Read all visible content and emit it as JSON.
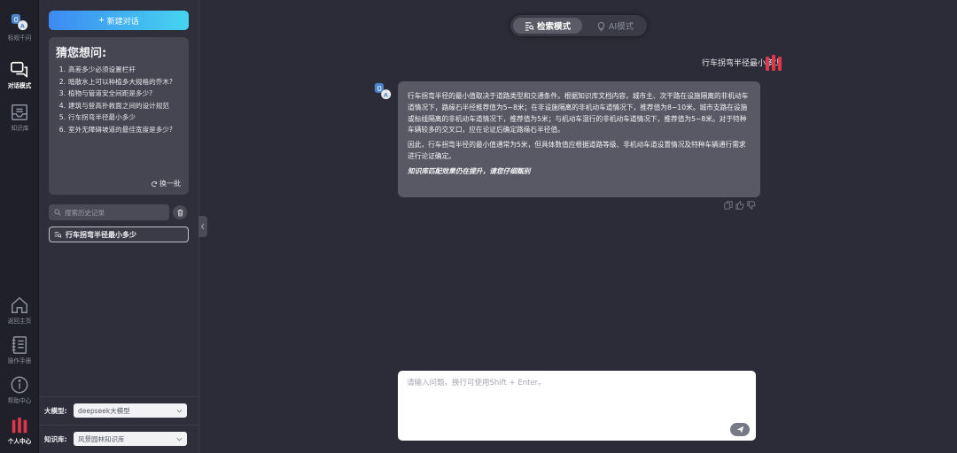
{
  "rail": {
    "items": [
      {
        "label": "标规千问",
        "icon": "app-logo-icon"
      },
      {
        "label": "对话模式",
        "icon": "chat-icon",
        "active": true
      },
      {
        "label": "知识库",
        "icon": "inbox-icon"
      },
      {
        "label": "返回主页",
        "icon": "home-icon"
      },
      {
        "label": "操作手册",
        "icon": "manual-icon"
      },
      {
        "label": "帮助中心",
        "icon": "info-icon"
      },
      {
        "label": "个人中心",
        "icon": "user-icon"
      }
    ]
  },
  "sidebar": {
    "new_chat_label": "新建对话",
    "guess": {
      "title": "猜您想问:",
      "items": [
        {
          "num": "1.",
          "text": "高差多少必须设置栏杆"
        },
        {
          "num": "2.",
          "text": "暗散水上可以种植多大规格的乔木?"
        },
        {
          "num": "3.",
          "text": "植物与管道安全间距是多少?"
        },
        {
          "num": "4.",
          "text": "建筑与登高扑救面之间的设计规范"
        },
        {
          "num": "5.",
          "text": "行车拐弯半径最小多少"
        },
        {
          "num": "6.",
          "text": "室外无障碍坡道的最佳宽度是多少?"
        }
      ],
      "refresh_label": "换一批"
    },
    "search_placeholder": "搜索历史记录",
    "history": [
      {
        "title": "行车拐弯半径最小多少"
      }
    ],
    "model_label": "大模型:",
    "model_value": "deepseek大模型",
    "kb_label": "知识库:",
    "kb_value": "风景园林知识库"
  },
  "mode_switch": {
    "search_mode": "检索模式",
    "ai_mode": "AI模式",
    "active": "search_mode"
  },
  "chat": {
    "user_message": "行车拐弯半径最小多少",
    "bot_paragraphs": [
      "行车拐弯半径的最小值取决于道路类型和交通条件。根据知识库文档内容，城市主、次干路在设施隔离的非机动车道情况下，路缘石半径推荐值为5~8米；在非设施隔离的非机动车道情况下，推荐值为8~10米。城市支路在设施或标线隔离的非机动车道情况下，推荐值为5米；与机动车混行的非机动车道情况下，推荐值为5~8米。对于特种车辆较多的交叉口，应在论证后确定路缘石半径值。",
      "因此，行车拐弯半径的最小值通常为5米，但具体数值应根据道路等级、非机动车道设置情况及特种车辆通行需求进行论证确定。"
    ],
    "bot_note": "知识库匹配效果仍在提升，请您仔细甄别"
  },
  "composer": {
    "placeholder": "请输入问题，换行可使用Shift + Enter。"
  }
}
